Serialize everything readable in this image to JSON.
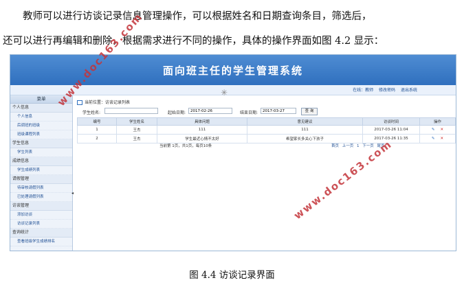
{
  "paragraph": {
    "line1": "教师可以进行访谈记录信息管理操作，可以根据姓名和日期查询条目，筛选后，",
    "line2": "还可以进行再编辑和删除，根据需求进行不同的操作，具体的操作界面如图 4.2  显示："
  },
  "app": {
    "title": "面向班主任的学生管理系统",
    "user_links": [
      "在线：教师",
      "修改密码",
      "退出系统"
    ]
  },
  "sidebar": {
    "header": "菜单",
    "groups": [
      {
        "label": "个人信息",
        "items": [
          "个人信息",
          "后调班的班级",
          "班级课程列表"
        ]
      },
      {
        "label": "学生信息",
        "items": [
          "学生列表"
        ]
      },
      {
        "label": "成绩信息",
        "items": [
          "学生成绩列表"
        ]
      },
      {
        "label": "请假管理",
        "items": [
          "待审核请假列表",
          "已处理请假列表"
        ]
      },
      {
        "label": "访谈管理",
        "items": [
          "添加访谈",
          "访谈记录列表"
        ]
      },
      {
        "label": "查询统计",
        "items": [
          "查看班级学生成绩排名"
        ]
      }
    ]
  },
  "main": {
    "breadcrumb": "当前位置：访谈记录列表",
    "filters": {
      "name_label": "学生姓名:",
      "name_value": "",
      "start_label": "起始日期:",
      "start_value": "2017-02-26",
      "end_label": "结束日期:",
      "end_value": "2017-03-27",
      "query_button": "查 询"
    },
    "table": {
      "columns": [
        "编号",
        "学生姓名",
        "具体问题",
        "意见建议",
        "访谈时间",
        "操作"
      ],
      "rows": [
        [
          "1",
          "王杰",
          "111",
          "111",
          "2017-03-26 11:04"
        ],
        [
          "2",
          "王杰",
          "学生最近心情不太好",
          "希望家长多关心下孩子",
          "2017-03-26 11:35"
        ]
      ]
    },
    "pager": {
      "summary": "当前第 1页，共1页，每页10条",
      "links": [
        "首页",
        "上一页",
        "1",
        "下一页",
        "尾页"
      ]
    }
  },
  "watermarks": [
    "www.doc163.com",
    "www.doc163.com"
  ],
  "caption": "图 4.4  访谈记录界面"
}
